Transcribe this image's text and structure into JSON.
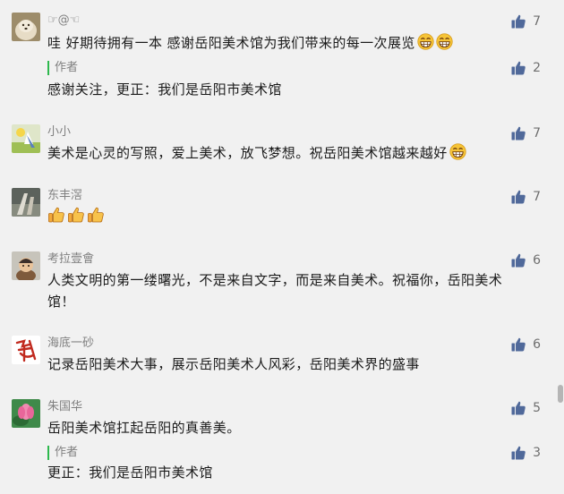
{
  "comments": [
    {
      "nickname": "☞@☜",
      "text": "哇  好期待拥有一本   感谢岳阳美术馆为我们带来的每一次展览",
      "emoji": "grin-emoji",
      "likes": "7",
      "reply": {
        "author": "作者",
        "text": "感谢关注，更正：我们是岳阳市美术馆",
        "likes": "2"
      }
    },
    {
      "nickname": "小小",
      "text": "美术是心灵的写照，爱上美术，放飞梦想。祝岳阳美术馆越来越好",
      "emoji": "grin-emoji",
      "likes": "7"
    },
    {
      "nickname": "东丰滘",
      "text": "",
      "emoji": "thumbs-up-emoji",
      "likes": "7"
    },
    {
      "nickname": "考拉壹會",
      "text_line1": "人类文明的第一缕曙光，不是来自文字，而是来自美术。祝福你，岳阳美术",
      "text_line2": "馆！",
      "likes": "6"
    },
    {
      "nickname": "海底一砂",
      "text": "记录岳阳美术大事，展示岳阳美术人风彩，岳阳美术界的盛事",
      "likes": "6"
    },
    {
      "nickname": "朱国华",
      "text": "岳阳美术馆扛起岳阳的真善美。",
      "likes": "5",
      "reply": {
        "author": "作者",
        "text": "更正：我们是岳阳市美术馆",
        "likes": "3"
      }
    }
  ],
  "colors": {
    "background": "#f1f1f1",
    "like_icon": "#50699a",
    "author_bar": "#2db84d"
  }
}
